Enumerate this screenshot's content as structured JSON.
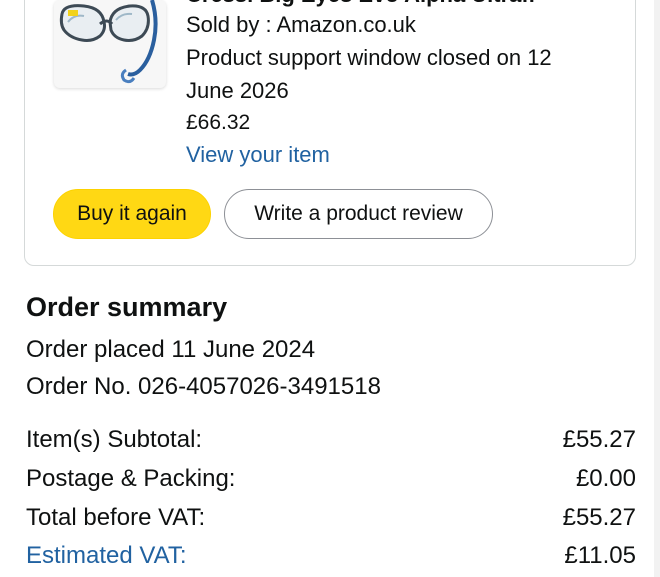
{
  "item": {
    "title": "Cressi Big Eyes Evo Alpha Ultrafl",
    "sold_by": "Sold by : Amazon.co.uk",
    "support_line1": "Product support window closed on 12",
    "support_line2": "June 2026",
    "price": "£66.32",
    "view_link": "View your item",
    "image_icon": "snorkel-mask-icon"
  },
  "actions": {
    "buy_again": "Buy it again",
    "write_review": "Write a product review"
  },
  "summary": {
    "title": "Order summary",
    "order_placed": "Order placed 11 June 2024",
    "order_number": "Order No. 026-4057026-3491518",
    "rows": [
      {
        "label": "Item(s) Subtotal:",
        "value": "£55.27"
      },
      {
        "label": "Postage & Packing:",
        "value": "£0.00"
      },
      {
        "label": "Total before VAT:",
        "value": "£55.27"
      },
      {
        "label": "Estimated VAT:",
        "value": "£11.05"
      }
    ]
  },
  "colors": {
    "accent_link": "#2162a1",
    "buy_button": "#ffd814",
    "border": "#d5d9d9"
  }
}
